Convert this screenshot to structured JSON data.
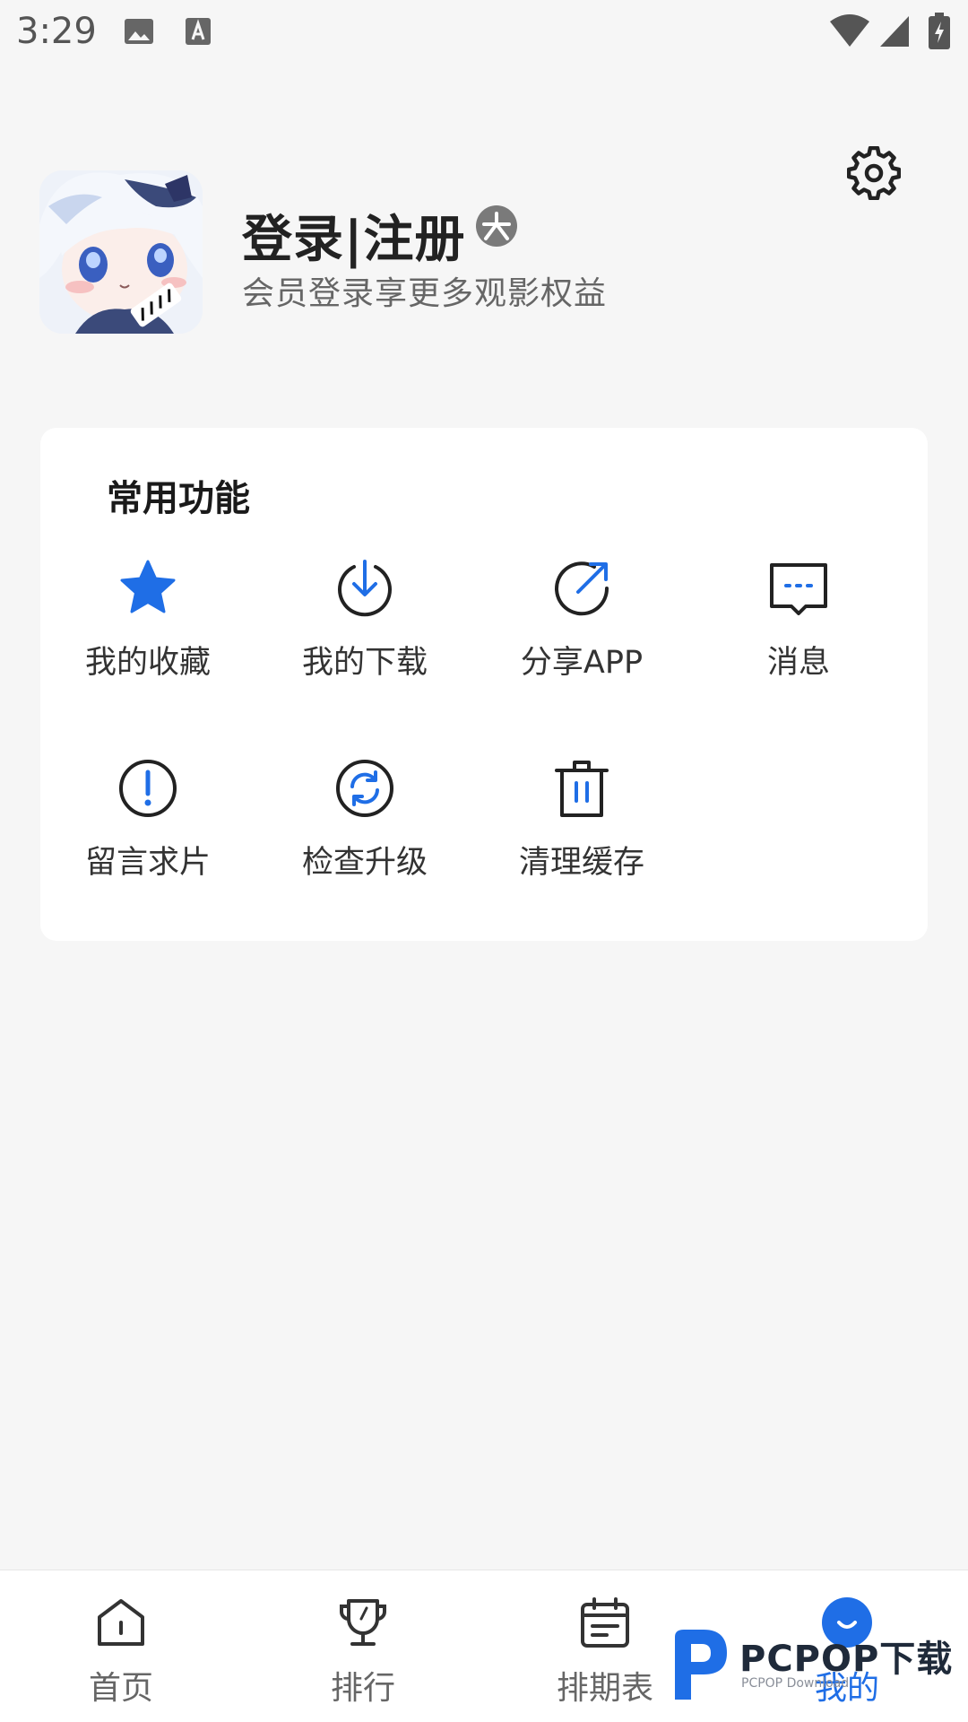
{
  "status_bar": {
    "time": "3:29",
    "icons": [
      "image-icon",
      "text-a-icon",
      "wifi-icon",
      "signal-icon",
      "battery-charging-icon"
    ]
  },
  "profile": {
    "avatar_icon": "anime-avatar-image",
    "title": "登录|注册",
    "subtitle": "会员登录享更多观影权益",
    "vip_badge_icon": "vip-badge-icon",
    "settings_icon": "gear-icon"
  },
  "functions": {
    "title": "常用功能",
    "items": [
      {
        "label": "我的收藏",
        "icon": "star-icon"
      },
      {
        "label": "我的下载",
        "icon": "download-icon"
      },
      {
        "label": "分享APP",
        "icon": "share-icon"
      },
      {
        "label": "消息",
        "icon": "message-icon"
      },
      {
        "label": "留言求片",
        "icon": "exclamation-icon"
      },
      {
        "label": "检查升级",
        "icon": "refresh-icon"
      },
      {
        "label": "清理缓存",
        "icon": "trash-icon"
      }
    ]
  },
  "bottom_nav": {
    "items": [
      {
        "label": "首页",
        "icon": "home-icon",
        "active": false
      },
      {
        "label": "排行",
        "icon": "trophy-icon",
        "active": false
      },
      {
        "label": "排期表",
        "icon": "calendar-icon",
        "active": false
      },
      {
        "label": "我的",
        "icon": "smile-icon",
        "active": true
      }
    ]
  },
  "watermark": {
    "main": "PCPOP下载",
    "sub": "PCPOP Download"
  },
  "colors": {
    "accent": "#1f6ee6",
    "background": "#f6f6f6",
    "card": "#ffffff"
  }
}
